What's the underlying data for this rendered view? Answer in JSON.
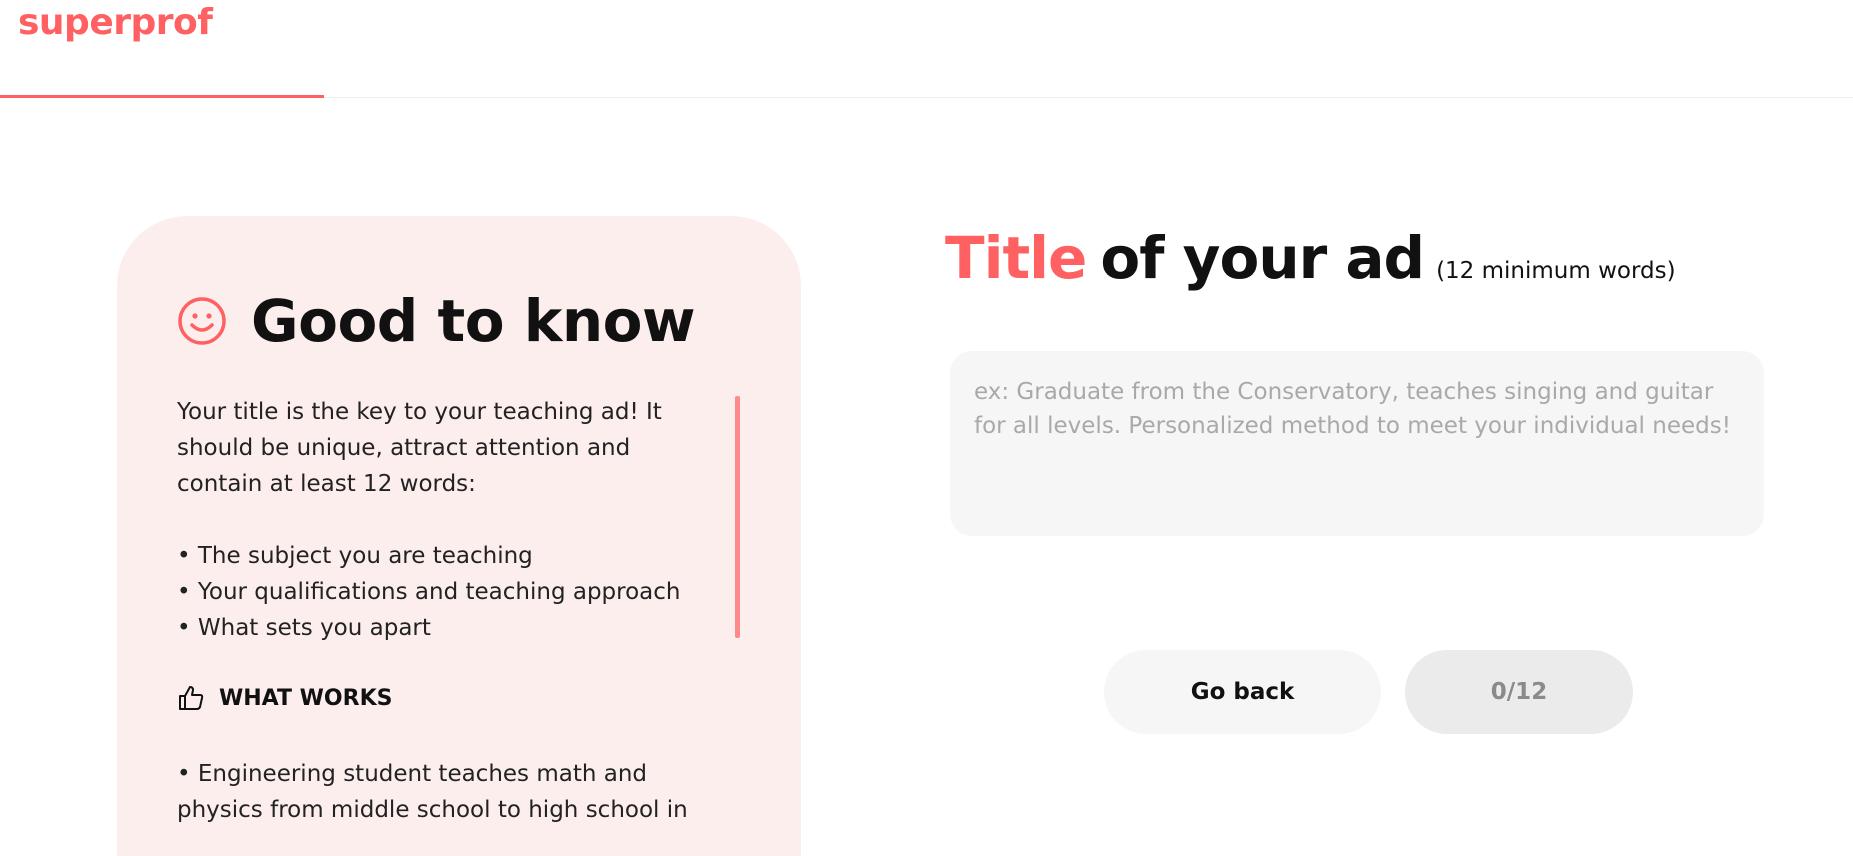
{
  "header": {
    "logo": "superprof",
    "progress_fraction": 0.175
  },
  "tips": {
    "title": "Good to know",
    "intro": "Your title is the key to your teaching ad! It should be unique, attract attention and contain at least 12 words:",
    "bullets": [
      "• The subject you are teaching",
      "• Your qualifications and teaching approach",
      "• What sets you apart"
    ],
    "what_works_label": "WHAT WORKS",
    "examples": [
      "• Engineering student teaches math and physics from middle school to high school in"
    ]
  },
  "form": {
    "title_accent": "Title",
    "title_rest": "of your ad",
    "title_note": "(12 minimum words)",
    "input_value": "",
    "input_placeholder": "ex: Graduate from the Conservatory, teaches singing and guitar for all levels. Personalized method to meet your individual needs!",
    "back_label": "Go back",
    "word_count": "0/12"
  },
  "colors": {
    "brand": "#ff6062",
    "card_bg": "#fdeeee",
    "input_bg": "#f6f6f6"
  }
}
